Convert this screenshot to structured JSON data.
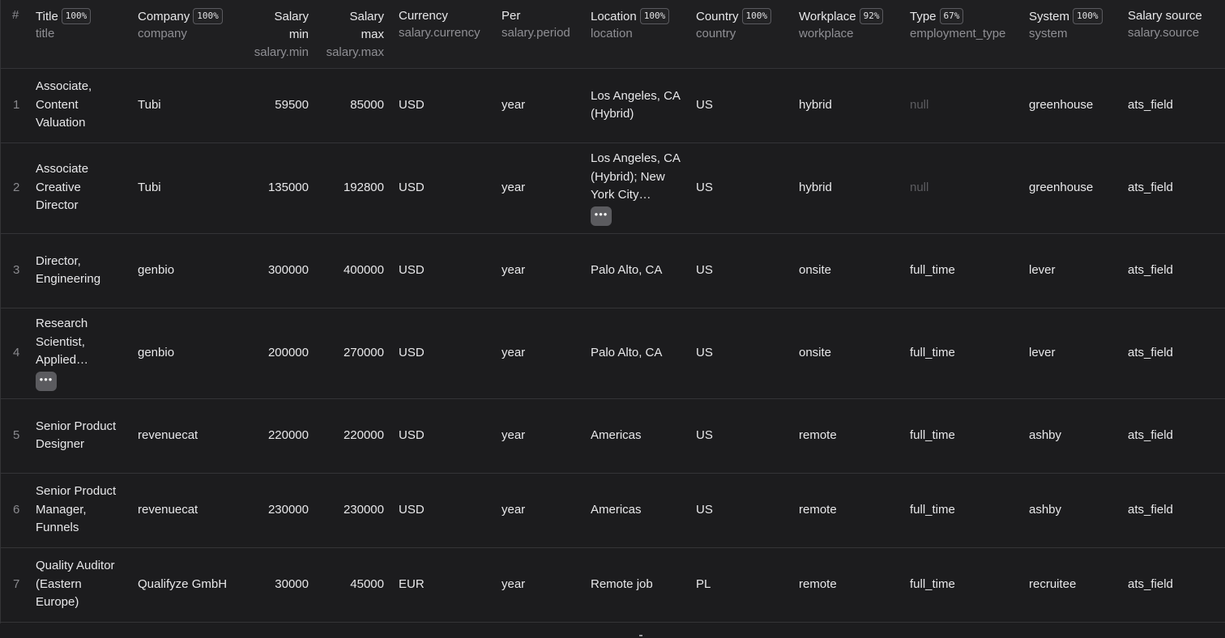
{
  "columns": [
    {
      "title": "#"
    },
    {
      "title": "Title",
      "badge": "100%",
      "key": "title"
    },
    {
      "title": "Company",
      "badge": "100%",
      "key": "company"
    },
    {
      "title_line1": "Salary",
      "title_line2": "min",
      "key": "salary.min"
    },
    {
      "title_line1": "Salary",
      "title_line2": "max",
      "key": "salary.max"
    },
    {
      "title": "Currency",
      "key": "salary.currency"
    },
    {
      "title": "Per",
      "key": "salary.period"
    },
    {
      "title": "Location",
      "badge": "100%",
      "key": "location"
    },
    {
      "title": "Country",
      "badge": "100%",
      "key": "country"
    },
    {
      "title": "Workplace",
      "badge": "92%",
      "key": "workplace"
    },
    {
      "title": "Type",
      "badge": "67%",
      "key": "employment_type"
    },
    {
      "title": "System",
      "badge": "100%",
      "key": "system"
    },
    {
      "title": "Salary source",
      "key": "salary.source"
    }
  ],
  "more_glyph": "•••",
  "rows": [
    {
      "idx": "1",
      "title": "Associate, Content Valuation",
      "company": "Tubi",
      "smin": "59500",
      "smax": "85000",
      "currency": "USD",
      "period": "year",
      "location": "Los Angeles, CA (Hybrid)",
      "country": "US",
      "workplace": "hybrid",
      "type": "null",
      "system": "greenhouse",
      "source": "ats_field"
    },
    {
      "idx": "2",
      "title": "Associate Creative Director",
      "company": "Tubi",
      "smin": "135000",
      "smax": "192800",
      "currency": "USD",
      "period": "year",
      "location": "Los Angeles, CA (Hybrid); New York City…",
      "country": "US",
      "workplace": "hybrid",
      "type": "null",
      "system": "greenhouse",
      "source": "ats_field"
    },
    {
      "idx": "3",
      "title": "Director, Engineering",
      "company": "genbio",
      "smin": "300000",
      "smax": "400000",
      "currency": "USD",
      "period": "year",
      "location": "Palo Alto, CA",
      "country": "US",
      "workplace": "onsite",
      "type": "full_time",
      "system": "lever",
      "source": "ats_field"
    },
    {
      "idx": "4",
      "title": "Research Scientist, Applied…",
      "company": "genbio",
      "smin": "200000",
      "smax": "270000",
      "currency": "USD",
      "period": "year",
      "location": "Palo Alto, CA",
      "country": "US",
      "workplace": "onsite",
      "type": "full_time",
      "system": "lever",
      "source": "ats_field"
    },
    {
      "idx": "5",
      "title": "Senior Product Designer",
      "company": "revenuecat",
      "smin": "220000",
      "smax": "220000",
      "currency": "USD",
      "period": "year",
      "location": "Americas",
      "country": "US",
      "workplace": "remote",
      "type": "full_time",
      "system": "ashby",
      "source": "ats_field"
    },
    {
      "idx": "6",
      "title": "Senior Product Manager, Funnels",
      "company": "revenuecat",
      "smin": "230000",
      "smax": "230000",
      "currency": "USD",
      "period": "year",
      "location": "Americas",
      "country": "US",
      "workplace": "remote",
      "type": "full_time",
      "system": "ashby",
      "source": "ats_field"
    },
    {
      "idx": "7",
      "title": "Quality Auditor (Eastern Europe)",
      "company": "Qualifyze GmbH",
      "smin": "30000",
      "smax": "45000",
      "currency": "EUR",
      "period": "year",
      "location": "Remote job",
      "country": "PL",
      "workplace": "remote",
      "type": "full_time",
      "system": "recruitee",
      "source": "ats_field"
    }
  ]
}
